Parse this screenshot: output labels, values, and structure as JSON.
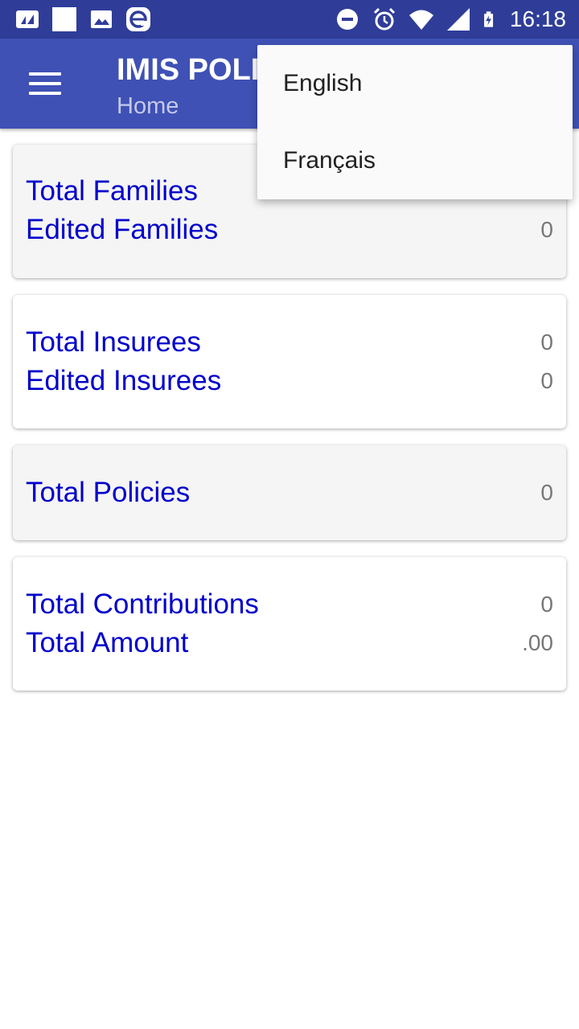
{
  "status_bar": {
    "time": "16:18",
    "left_icons": [
      "nfc-icon",
      "notification-square-icon",
      "image-icon",
      "e-app-icon"
    ],
    "right_icons": [
      "do-not-disturb-icon",
      "alarm-icon",
      "wifi-icon",
      "signal-icon",
      "battery-charging-icon"
    ]
  },
  "app_bar": {
    "title": "IMIS POLI",
    "subtitle": "Home"
  },
  "cards": [
    {
      "bg": "grey",
      "rows": [
        {
          "label": "Total Families",
          "value": ""
        },
        {
          "label": "Edited Families",
          "value": "0"
        }
      ]
    },
    {
      "bg": "white",
      "rows": [
        {
          "label": "Total Insurees",
          "value": "0"
        },
        {
          "label": "Edited Insurees",
          "value": "0"
        }
      ]
    },
    {
      "bg": "grey",
      "rows": [
        {
          "label": "Total Policies",
          "value": "0"
        }
      ]
    },
    {
      "bg": "white",
      "rows": [
        {
          "label": "Total Contributions",
          "value": "0"
        },
        {
          "label": "Total Amount",
          "value": ".00"
        }
      ]
    }
  ],
  "language_menu": {
    "items": [
      "English",
      "Français"
    ]
  },
  "colors": {
    "status_bar": "#2f3d99",
    "app_bar": "#3f51b5",
    "label_text": "#0000cc",
    "value_text": "#777777"
  }
}
